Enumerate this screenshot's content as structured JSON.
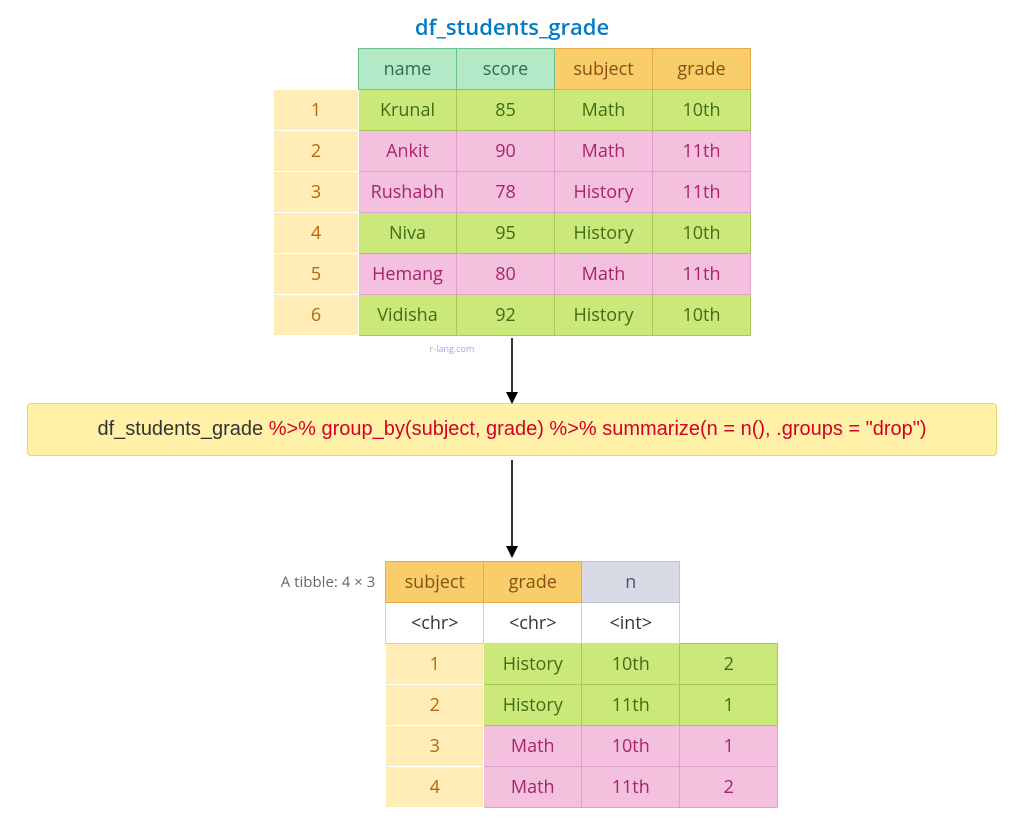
{
  "title": "df_students_grade",
  "watermark": "r-lang.com",
  "table1": {
    "headers": {
      "c1": "name",
      "c2": "score",
      "c3": "subject",
      "c4": "grade"
    },
    "rows": [
      {
        "idx": "1",
        "name": "Krunal",
        "score": "85",
        "subject": "Math",
        "grade": "10th",
        "style": "green"
      },
      {
        "idx": "2",
        "name": "Ankit",
        "score": "90",
        "subject": "Math",
        "grade": "11th",
        "style": "pink"
      },
      {
        "idx": "3",
        "name": "Rushabh",
        "score": "78",
        "subject": "History",
        "grade": "11th",
        "style": "pink"
      },
      {
        "idx": "4",
        "name": "Niva",
        "score": "95",
        "subject": "History",
        "grade": "10th",
        "style": "green"
      },
      {
        "idx": "5",
        "name": "Hemang",
        "score": "80",
        "subject": "Math",
        "grade": "11th",
        "style": "pink"
      },
      {
        "idx": "6",
        "name": "Vidisha",
        "score": "92",
        "subject": "History",
        "grade": "10th",
        "style": "green"
      }
    ]
  },
  "code": {
    "part1": "df_students_grade ",
    "pipe1": "%>%",
    "group": " group_by(subject, grade) ",
    "pipe2": "%>%",
    "summ": " summarize(n = n(), .groups = \"drop\")"
  },
  "tibble_label": "A tibble: 4 × 3",
  "table2": {
    "headers": {
      "c1": "subject",
      "c2": "grade",
      "c3": "n"
    },
    "types": {
      "c1": "<chr>",
      "c2": "<chr>",
      "c3": "<int>"
    },
    "rows": [
      {
        "idx": "1",
        "subject": "History",
        "grade": "10th",
        "n": "2",
        "style": "green"
      },
      {
        "idx": "2",
        "subject": "History",
        "grade": "11th",
        "n": "1",
        "style": "green"
      },
      {
        "idx": "3",
        "subject": "Math",
        "grade": "10th",
        "n": "1",
        "style": "pink"
      },
      {
        "idx": "4",
        "subject": "Math",
        "grade": "11th",
        "n": "2",
        "style": "pink"
      }
    ]
  }
}
